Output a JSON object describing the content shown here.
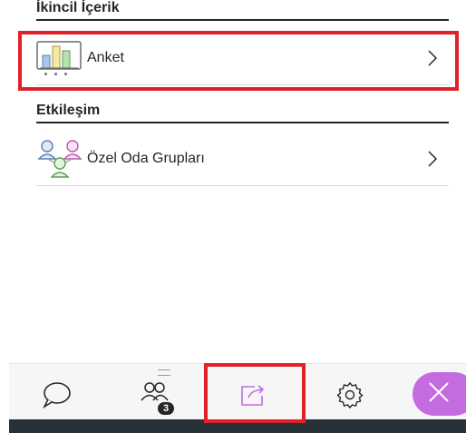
{
  "sections": {
    "secondary_content": {
      "title": "İkincil İçerik",
      "item_label": "Anket"
    },
    "interaction": {
      "title": "Etkileşim",
      "item_label": "Özel Oda Grupları"
    }
  },
  "toolbar": {
    "attendees_badge": "3"
  },
  "icons": {
    "poll": "bar-chart-icon",
    "breakout": "groups-icon",
    "chat": "chat-icon",
    "attendees": "people-icon",
    "share": "share-content-icon",
    "settings": "gear-icon",
    "close": "close-icon",
    "chevron": "chevron-right-icon"
  },
  "colors": {
    "highlight": "#e2202a",
    "accent": "#c46be0",
    "text": "#262626",
    "dark_bar": "#263238"
  }
}
